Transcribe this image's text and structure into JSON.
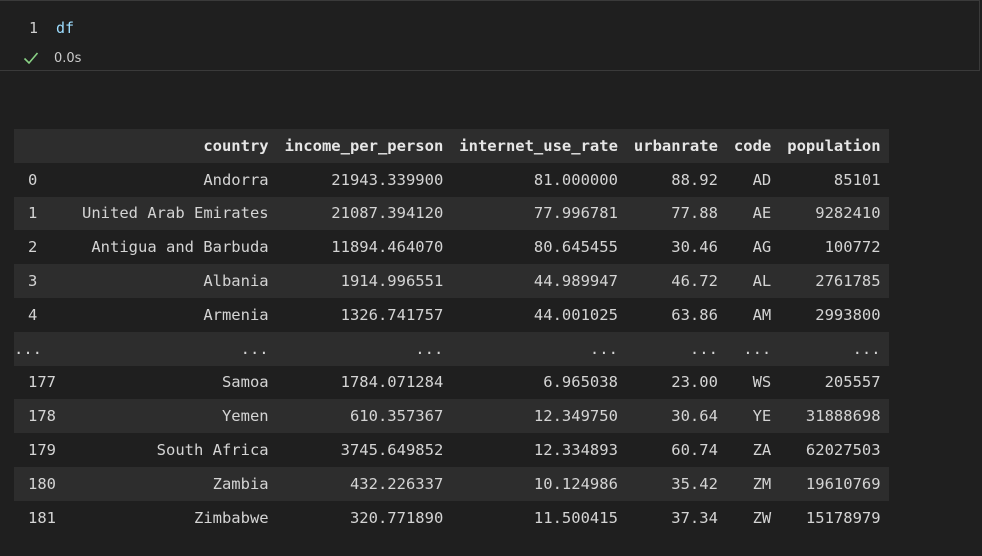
{
  "input": {
    "line_number": "1",
    "code": "df",
    "exec_time": "0.0s",
    "status_color": "#89d185"
  },
  "table": {
    "columns": [
      "country",
      "income_per_person",
      "internet_use_rate",
      "urbanrate",
      "code",
      "population"
    ],
    "rows": [
      {
        "index": "0",
        "country": "Andorra",
        "income_per_person": "21943.339900",
        "internet_use_rate": "81.000000",
        "urbanrate": "88.92",
        "code": "AD",
        "population": "85101"
      },
      {
        "index": "1",
        "country": "United Arab Emirates",
        "income_per_person": "21087.394120",
        "internet_use_rate": "77.996781",
        "urbanrate": "77.88",
        "code": "AE",
        "population": "9282410"
      },
      {
        "index": "2",
        "country": "Antigua and Barbuda",
        "income_per_person": "11894.464070",
        "internet_use_rate": "80.645455",
        "urbanrate": "30.46",
        "code": "AG",
        "population": "100772"
      },
      {
        "index": "3",
        "country": "Albania",
        "income_per_person": "1914.996551",
        "internet_use_rate": "44.989947",
        "urbanrate": "46.72",
        "code": "AL",
        "population": "2761785"
      },
      {
        "index": "4",
        "country": "Armenia",
        "income_per_person": "1326.741757",
        "internet_use_rate": "44.001025",
        "urbanrate": "63.86",
        "code": "AM",
        "population": "2993800"
      },
      {
        "index": "...",
        "country": "...",
        "income_per_person": "...",
        "internet_use_rate": "...",
        "urbanrate": "...",
        "code": "...",
        "population": "..."
      },
      {
        "index": "177",
        "country": "Samoa",
        "income_per_person": "1784.071284",
        "internet_use_rate": "6.965038",
        "urbanrate": "23.00",
        "code": "WS",
        "population": "205557"
      },
      {
        "index": "178",
        "country": "Yemen",
        "income_per_person": "610.357367",
        "internet_use_rate": "12.349750",
        "urbanrate": "30.64",
        "code": "YE",
        "population": "31888698"
      },
      {
        "index": "179",
        "country": "South Africa",
        "income_per_person": "3745.649852",
        "internet_use_rate": "12.334893",
        "urbanrate": "60.74",
        "code": "ZA",
        "population": "62027503"
      },
      {
        "index": "180",
        "country": "Zambia",
        "income_per_person": "432.226337",
        "internet_use_rate": "10.124986",
        "urbanrate": "35.42",
        "code": "ZM",
        "population": "19610769"
      },
      {
        "index": "181",
        "country": "Zimbabwe",
        "income_per_person": "320.771890",
        "internet_use_rate": "11.500415",
        "urbanrate": "37.34",
        "code": "ZW",
        "population": "15178979"
      }
    ]
  }
}
